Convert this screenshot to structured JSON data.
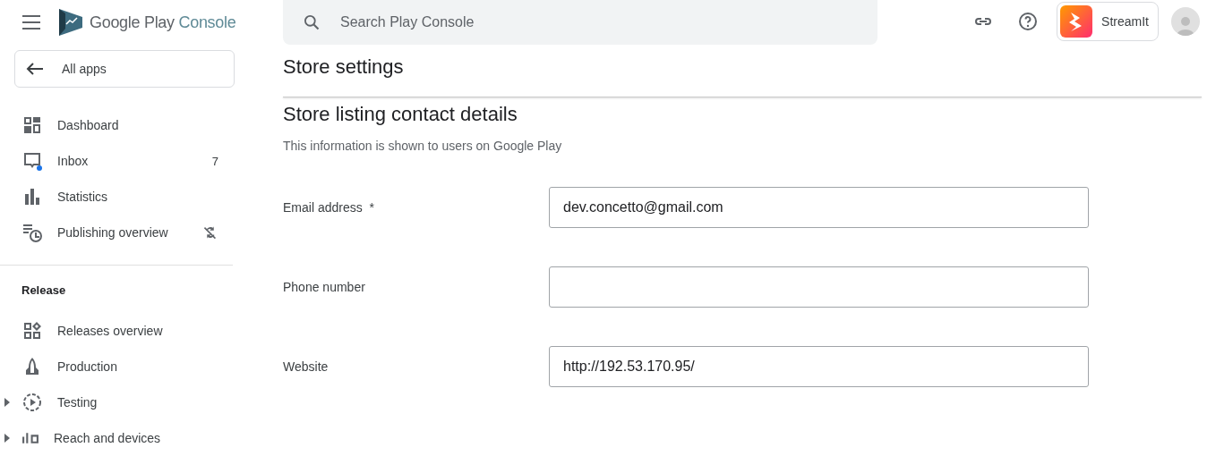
{
  "header": {
    "brand": {
      "main": "Google Play",
      "accent": "Console"
    },
    "search": {
      "placeholder": "Search Play Console"
    },
    "app": {
      "name": "StreamIt"
    }
  },
  "sidebar": {
    "back_button": {
      "label": "All apps"
    },
    "items": [
      {
        "label": "Dashboard"
      },
      {
        "label": "Inbox",
        "badge": "7",
        "unread": true
      },
      {
        "label": "Statistics"
      },
      {
        "label": "Publishing overview",
        "sync_off": true
      }
    ],
    "sections": [
      {
        "title": "Release",
        "items": [
          {
            "label": "Releases overview"
          },
          {
            "label": "Production"
          },
          {
            "label": "Testing",
            "expanded": false
          },
          {
            "label": "Reach and devices",
            "expanded": false
          }
        ]
      }
    ]
  },
  "page": {
    "title": "Store settings",
    "section": {
      "title": "Store listing contact details",
      "description": "This information is shown to users on Google Play",
      "fields": [
        {
          "label": "Email address",
          "required_mark": "*",
          "value": "dev.concetto@gmail.com"
        },
        {
          "label": "Phone number"
        },
        {
          "label": "Website",
          "value": "http://192.53.170.95/"
        }
      ]
    }
  }
}
